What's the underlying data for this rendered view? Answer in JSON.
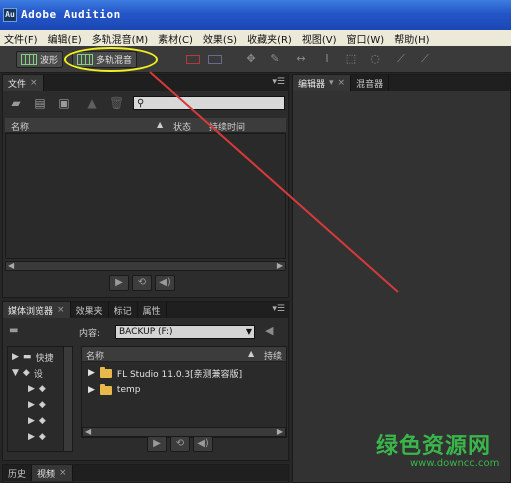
{
  "window": {
    "app_icon_text": "Au",
    "title": "Adobe Audition"
  },
  "menubar": [
    "文件(F)",
    "编辑(E)",
    "多轨混音(M)",
    "素材(C)",
    "效果(S)",
    "收藏夹(R)",
    "视图(V)",
    "窗口(W)",
    "帮助(H)"
  ],
  "toolbar": {
    "waveform_label": "波形",
    "multitrack_label": "多轨混音"
  },
  "files_panel": {
    "tab_label": "文件",
    "columns": {
      "name": "名称",
      "status": "状态",
      "duration": "持续时间"
    }
  },
  "editor_panel": {
    "tab_editor": "编辑器",
    "tab_mixer": "混音器"
  },
  "media_panel": {
    "tabs": [
      "媒体浏览器",
      "效果夹",
      "标记",
      "属性"
    ],
    "content_label": "内容:",
    "content_value": "BACKUP (F:)",
    "tree_rows": [
      "快捷",
      "设"
    ],
    "list_header_name": "名称",
    "list_header_duration": "持续",
    "folders": [
      "FL Studio 11.0.3[亲测兼容版]",
      "temp"
    ]
  },
  "bottom_tabs": [
    "历史",
    "视频"
  ],
  "watermark": {
    "main": "绿色资源网",
    "sub": "www.downcc.com"
  },
  "colors": {
    "accent_highlight": "#f2f01c",
    "annotation_arrow": "#d63a3a",
    "watermark": "#39b54a"
  }
}
